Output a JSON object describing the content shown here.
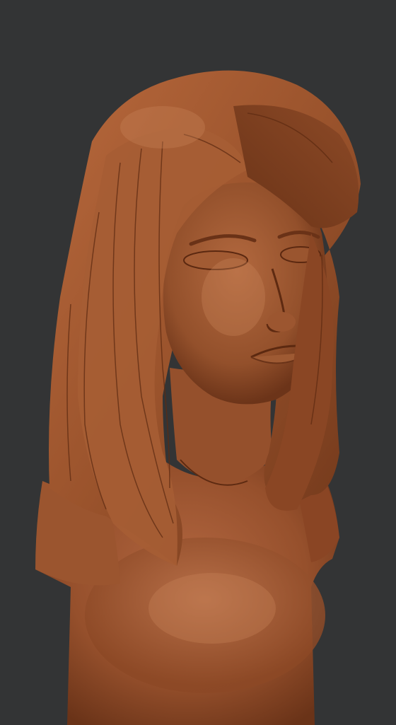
{
  "viewport": {
    "background_color": "#333435",
    "subject": "clay-sculpt-girl-bust"
  },
  "palette": {
    "clay_light": "#b86a3e",
    "clay_mid": "#99502a",
    "clay_dark": "#6e3519",
    "clay_deep": "#4d220e",
    "highlight": "#c98458"
  }
}
